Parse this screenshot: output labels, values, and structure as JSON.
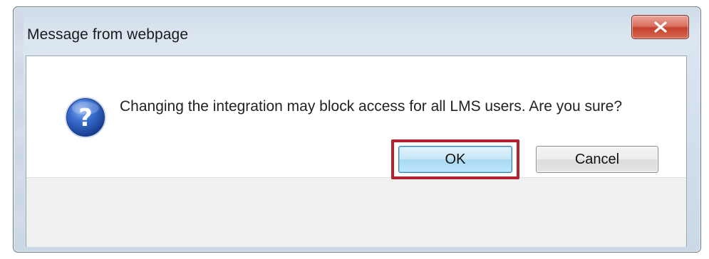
{
  "dialog": {
    "title": "Message from webpage",
    "close_icon": "close-x-icon",
    "close_color": "#c4412d",
    "message_icon": "question-icon",
    "message": "Changing the integration may block access for all LMS users. Are you sure?",
    "highlight_color": "#b3202e"
  },
  "buttons": {
    "ok_label": "OK",
    "cancel_label": "Cancel"
  }
}
